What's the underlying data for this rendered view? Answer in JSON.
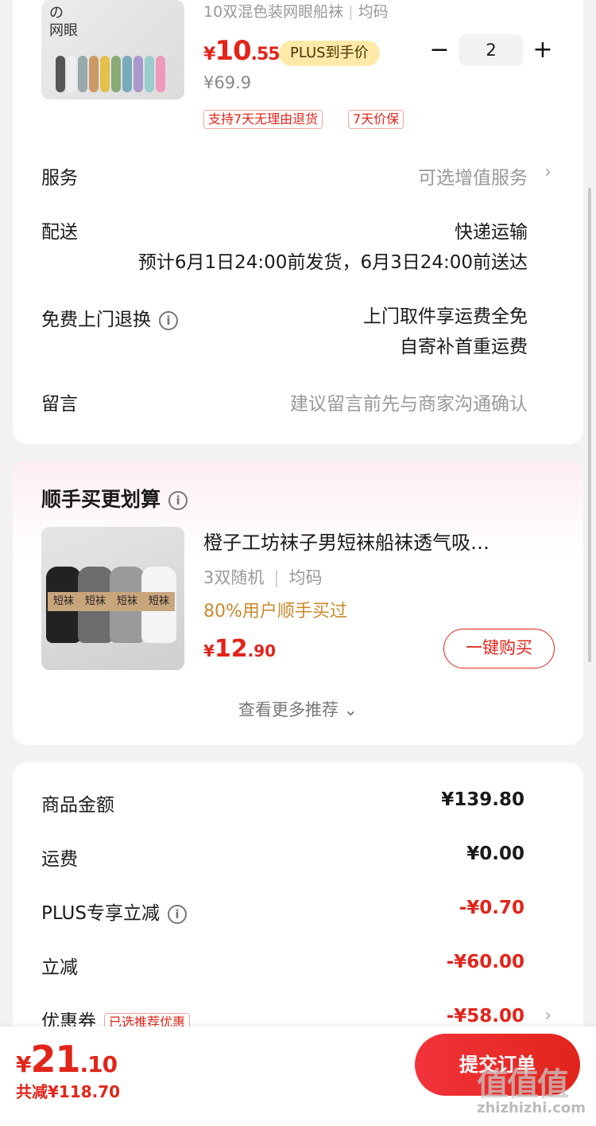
{
  "product": {
    "image_tag_1": "の",
    "image_tag_2": "网眼",
    "spec": "10双混色装网眼船袜",
    "spec_size": "均码",
    "price_yen": "¥",
    "price_int": "10",
    "price_dec": ".55",
    "plus_badge": "PLUS到手价",
    "original_price": "¥69.9",
    "tags": [
      "支持7天无理由退货",
      "7天价保"
    ],
    "quantity": "2",
    "minus_symbol": "−",
    "plus_symbol": "+"
  },
  "rows": {
    "service_label": "服务",
    "service_value": "可选增值服务",
    "delivery_label": "配送",
    "delivery_method": "快递运输",
    "delivery_eta": "预计6月1日24:00前发货，6月3日24:00前送达",
    "return_label": "免费上门退换",
    "return_line1": "上门取件享运费全免",
    "return_line2": "自寄补首重运费",
    "message_label": "留言",
    "message_placeholder": "建议留言前先与商家沟通确认",
    "chevron": "›",
    "info_glyph": "i"
  },
  "recommend": {
    "title": "顺手买更划算",
    "item_title": "橙子工坊袜子男短袜船袜透气吸…",
    "spec": "3双随机",
    "size": "均码",
    "percent_text": "80%用户顺手买过",
    "price_yen": "¥",
    "price_int": "12",
    "price_dec": ".90",
    "buy_button": "一键购买",
    "more_link": "查看更多推荐 ⌄",
    "sock_label": "短袜"
  },
  "summary": {
    "goods_label": "商品金额",
    "goods_value": "¥139.80",
    "shipping_label": "运费",
    "shipping_value": "¥0.00",
    "plus_label": "PLUS专享立减",
    "plus_value": "-¥0.70",
    "discount_label": "立减",
    "discount_value": "-¥60.00",
    "coupon_label": "优惠券",
    "coupon_tag": "已选推荐优惠",
    "coupon_value": "-¥58.00"
  },
  "bottom": {
    "total_yen": "¥",
    "total_int": "21",
    "total_dec": ".10",
    "saved": "共减¥118.70",
    "submit_button": "提交订单",
    "watermark": "值值值",
    "watermark_url": "zhizhizhi.com"
  },
  "colors": {
    "accent_red": "#e1251b",
    "plus_gold": "#ffe9a8",
    "percent_orange": "#c98a2b"
  },
  "icons": [
    "info-icon",
    "chevron-right-icon",
    "minus-icon",
    "plus-icon",
    "chevron-down-icon"
  ]
}
